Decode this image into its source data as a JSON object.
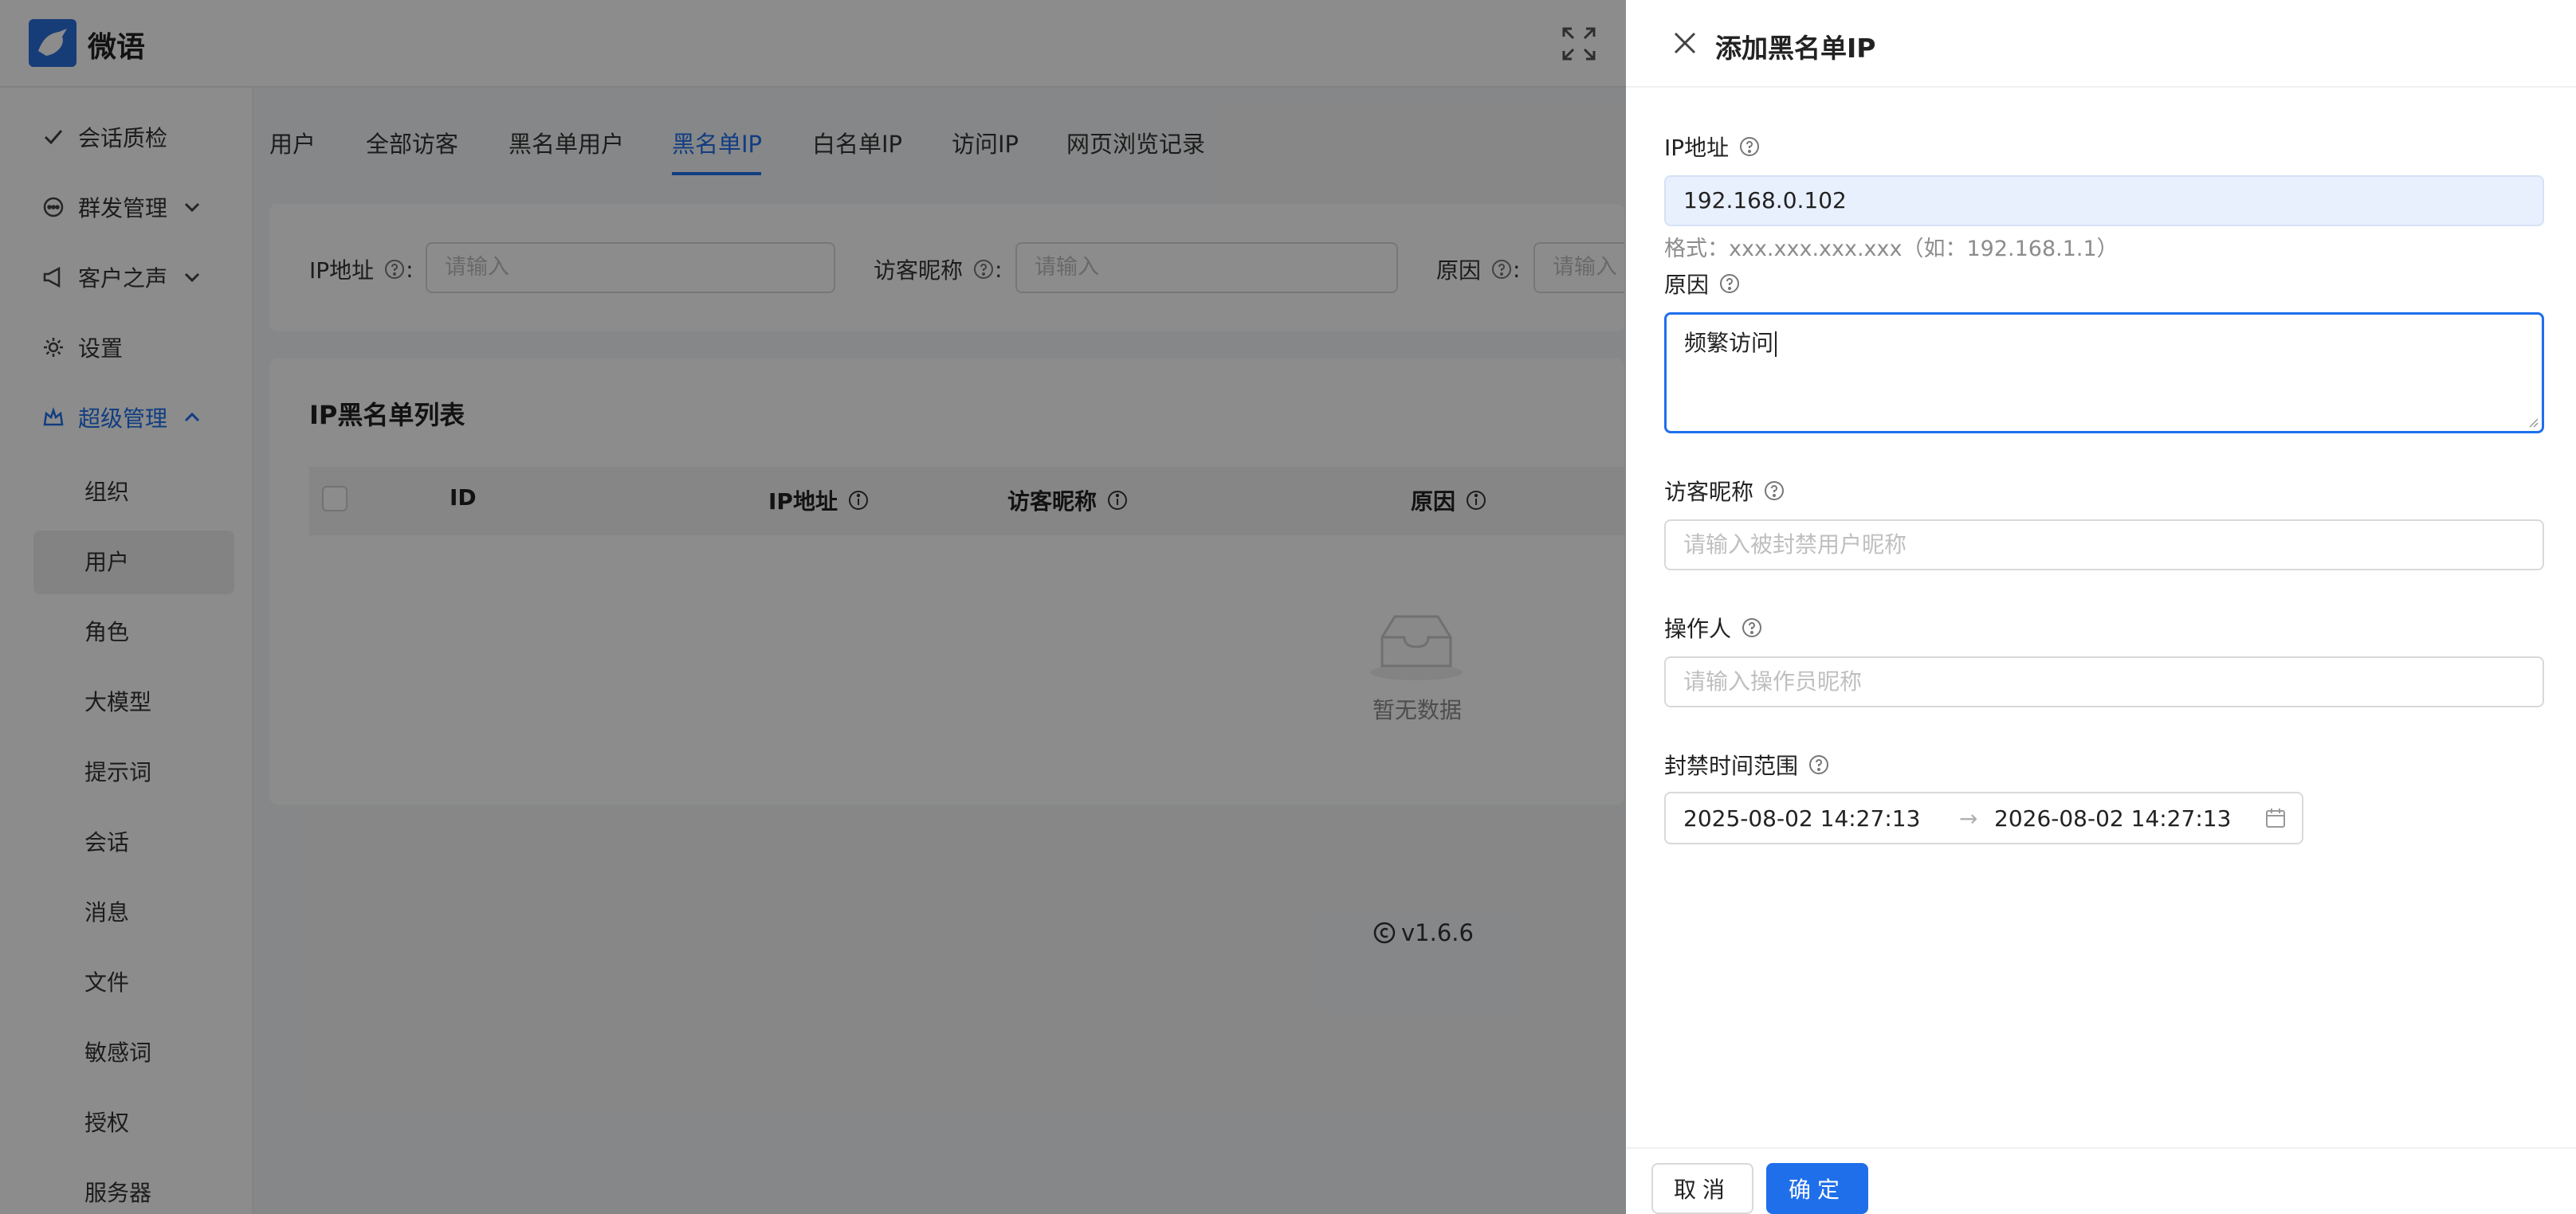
{
  "app": {
    "brand": "微语"
  },
  "sidebar": {
    "groups": [
      {
        "label": "会话质检"
      },
      {
        "label": "群发管理"
      },
      {
        "label": "客户之声"
      },
      {
        "label": "设置"
      },
      {
        "label": "超级管理"
      }
    ],
    "sub_items": [
      "组织",
      "用户",
      "角色",
      "大模型",
      "提示词",
      "会话",
      "消息",
      "文件",
      "敏感词",
      "授权",
      "服务器"
    ],
    "selected_sub_item": "用户"
  },
  "tabs": [
    "用户",
    "全部访客",
    "黑名单用户",
    "黑名单IP",
    "白名单IP",
    "访问IP",
    "网页浏览记录"
  ],
  "active_tab": "黑名单IP",
  "filters": {
    "ip_label": "IP地址",
    "ip_placeholder": "请输入",
    "nickname_label": "访客昵称",
    "nickname_placeholder": "请输入",
    "reason_label": "原因",
    "reason_placeholder": "请输入",
    "colon": ":"
  },
  "list": {
    "title": "IP黑名单列表",
    "columns": [
      "ID",
      "IP地址",
      "访客昵称",
      "原因"
    ],
    "empty_text": "暂无数据"
  },
  "footer": {
    "version": "v1.6.6"
  },
  "drawer": {
    "title": "添加黑名单IP",
    "ip": {
      "label": "IP地址",
      "value": "192.168.0.102",
      "hint": "格式：xxx.xxx.xxx.xxx（如：192.168.1.1）"
    },
    "reason": {
      "label": "原因",
      "value": "频繁访问"
    },
    "nickname": {
      "label": "访客昵称",
      "placeholder": "请输入被封禁用户昵称"
    },
    "operator": {
      "label": "操作人",
      "placeholder": "请输入操作员昵称"
    },
    "time_range": {
      "label": "封禁时间范围",
      "start": "2025-08-02 14:27:13",
      "end": "2026-08-02 14:27:13",
      "separator": "→"
    },
    "cancel_label": "取消",
    "ok_label": "确定"
  },
  "colors": {
    "accent": "#1f6feb",
    "mask": "rgba(0,0,0,0.45)",
    "autofill": "#e8f0fe"
  }
}
